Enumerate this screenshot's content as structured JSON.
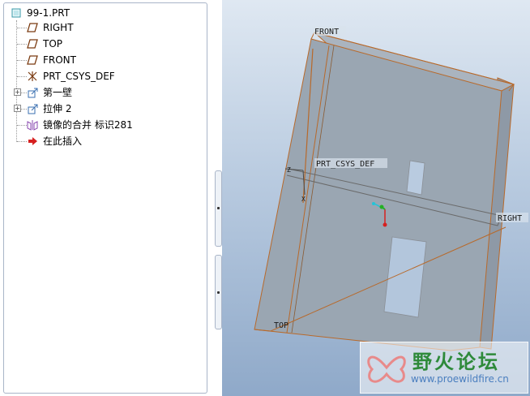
{
  "model_tree": {
    "root_label": "99-1.PRT",
    "items": [
      {
        "label": "RIGHT",
        "icon": "datum-plane-icon",
        "expandable": false
      },
      {
        "label": "TOP",
        "icon": "datum-plane-icon",
        "expandable": false
      },
      {
        "label": "FRONT",
        "icon": "datum-plane-icon",
        "expandable": false
      },
      {
        "label": "PRT_CSYS_DEF",
        "icon": "coordinate-system-icon",
        "expandable": false
      },
      {
        "label": "第一壁",
        "icon": "sheetmetal-wall-icon",
        "expandable": true
      },
      {
        "label": "拉伸 2",
        "icon": "extrude-icon",
        "expandable": true
      },
      {
        "label": "镜像的合并 标识281",
        "icon": "mirror-merge-icon",
        "expandable": false
      },
      {
        "label": "在此插入",
        "icon": "insert-here-arrow-icon",
        "expandable": false
      }
    ]
  },
  "viewport": {
    "datum_labels": {
      "front": "FRONT",
      "right": "RIGHT",
      "top": "TOP",
      "csys": "PRT_CSYS_DEF"
    }
  },
  "watermark": {
    "title": "野火论坛",
    "url": "www.proewildfire.cn"
  },
  "colors": {
    "part_fill": "#9aa6b2",
    "datum_edge": "#b8692a",
    "background_top": "#dfe8f2",
    "background_bottom": "#8fa9c9"
  }
}
